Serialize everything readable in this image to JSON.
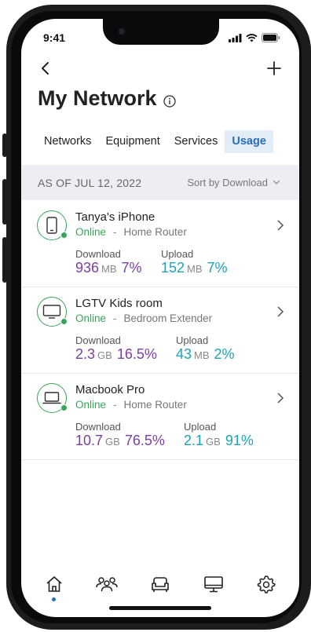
{
  "status_bar": {
    "time": "9:41"
  },
  "header": {
    "title": "My Network"
  },
  "tabs": [
    {
      "label": "Networks",
      "active": false
    },
    {
      "label": "Equipment",
      "active": false
    },
    {
      "label": "Services",
      "active": false
    },
    {
      "label": "Usage",
      "active": true
    }
  ],
  "list_header": {
    "as_of": "AS OF JUL 12, 2022",
    "sort_label": "Sort by Download"
  },
  "devices": [
    {
      "name": "Tanya's iPhone",
      "status": "Online",
      "separator": "-",
      "location": "Home Router",
      "download_label": "Download",
      "download_value": "936",
      "download_unit": "MB",
      "download_pct": "7%",
      "upload_label": "Upload",
      "upload_value": "152",
      "upload_unit": "MB",
      "upload_pct": "7%",
      "icon": "phone-icon"
    },
    {
      "name": "LGTV Kids room",
      "status": "Online",
      "separator": "-",
      "location": "Bedroom Extender",
      "download_label": "Download",
      "download_value": "2.3",
      "download_unit": "GB",
      "download_pct": "16.5%",
      "upload_label": "Upload",
      "upload_value": "43",
      "upload_unit": "MB",
      "upload_pct": "2%",
      "icon": "tv-icon"
    },
    {
      "name": "Macbook Pro",
      "status": "Online",
      "separator": "-",
      "location": "Home Router",
      "download_label": "Download",
      "download_value": "10.7",
      "download_unit": "GB",
      "download_pct": "76.5%",
      "upload_label": "Upload",
      "upload_value": "2.1",
      "upload_unit": "GB",
      "upload_pct": "91%",
      "icon": "laptop-icon"
    }
  ],
  "bottom_nav": [
    {
      "icon": "home-icon",
      "active": true
    },
    {
      "icon": "people-icon",
      "active": false
    },
    {
      "icon": "couch-icon",
      "active": false
    },
    {
      "icon": "monitor-icon",
      "active": false
    },
    {
      "icon": "gear-icon",
      "active": false
    }
  ],
  "colors": {
    "accent": "#2a6db5",
    "online": "#3aa55a",
    "download": "#7b3fa0",
    "upload": "#1fa3b5"
  }
}
